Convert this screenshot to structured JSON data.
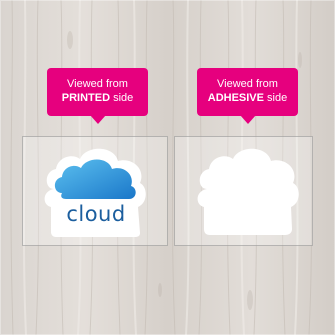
{
  "callouts": {
    "left": {
      "line1": "Viewed from",
      "emphasis": "PRINTED",
      "suffix": " side"
    },
    "right": {
      "line1": "Viewed from",
      "emphasis": "ADHESIVE",
      "suffix": " side"
    }
  },
  "sticker": {
    "word": "cloud"
  },
  "colors": {
    "callout": "#e6007e",
    "cloud_light": "#4fb3ea",
    "cloud_dark": "#1a77c9",
    "text_blue": "#1b5e9e"
  }
}
